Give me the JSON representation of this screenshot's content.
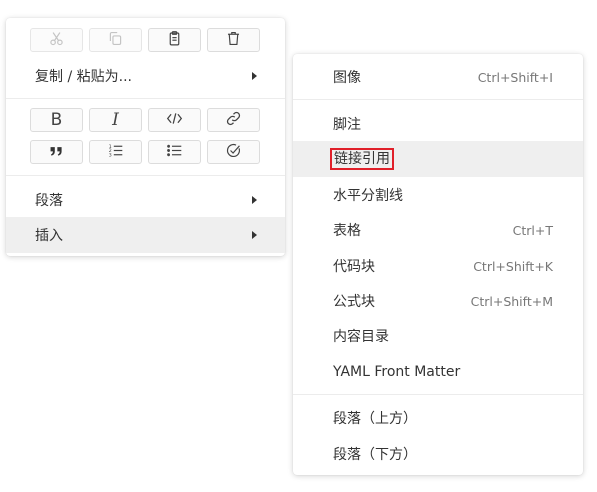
{
  "main_menu": {
    "toolbar_icons": {
      "cut": "scissors-icon",
      "copy": "copy-icon",
      "paste": "clipboard-icon",
      "delete": "trash-icon",
      "bold": "B",
      "italic": "I",
      "code": "</>",
      "link": "link-icon",
      "quote": "❞",
      "ordered_list": "ordered-list-icon",
      "unordered_list": "unordered-list-icon",
      "task": "check-circle-icon"
    },
    "copy_paste_as_label": "复制 / 粘贴为...",
    "paragraph_label": "段落",
    "insert_label": "插入"
  },
  "insert_submenu": {
    "items": [
      {
        "label": "图像",
        "shortcut": "Ctrl+Shift+I"
      },
      {
        "label": "脚注",
        "shortcut": ""
      },
      {
        "label": "链接引用",
        "shortcut": ""
      },
      {
        "label": "水平分割线",
        "shortcut": ""
      },
      {
        "label": "表格",
        "shortcut": "Ctrl+T"
      },
      {
        "label": "代码块",
        "shortcut": "Ctrl+Shift+K"
      },
      {
        "label": "公式块",
        "shortcut": "Ctrl+Shift+M"
      },
      {
        "label": "内容目录",
        "shortcut": ""
      },
      {
        "label": "YAML Front Matter",
        "shortcut": ""
      },
      {
        "label": "段落（上方）",
        "shortcut": ""
      },
      {
        "label": "段落（下方）",
        "shortcut": ""
      }
    ]
  },
  "colors": {
    "hover_background": "#efefef",
    "highlight_border": "#e0202a"
  }
}
